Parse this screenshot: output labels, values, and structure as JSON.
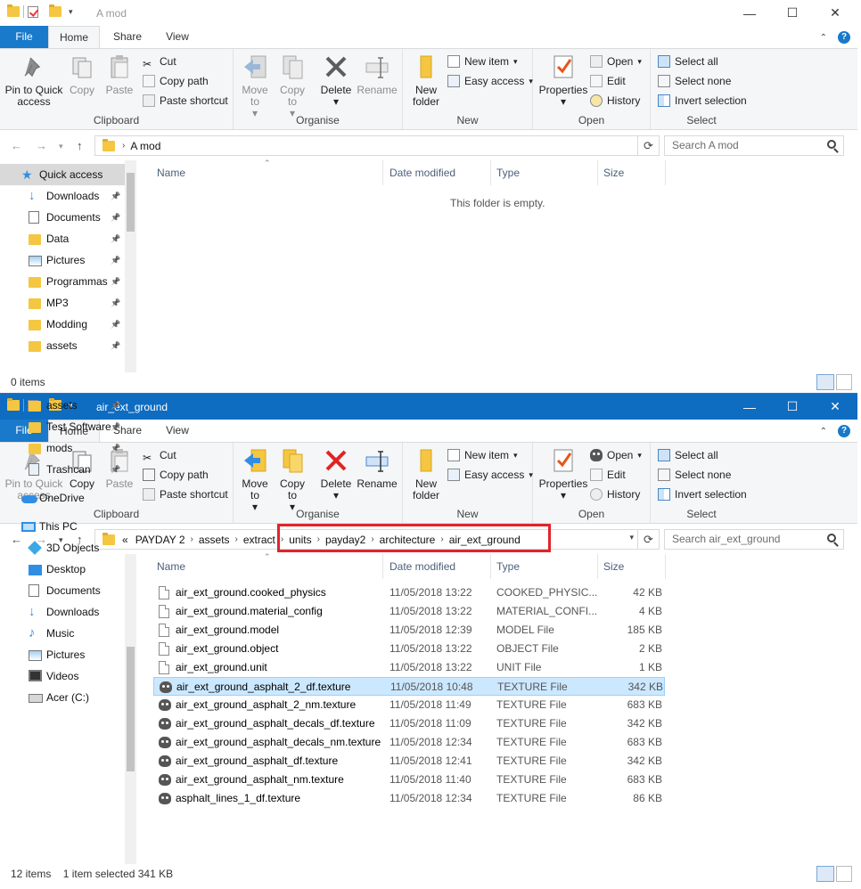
{
  "colors": {
    "accent": "#1979ca",
    "title_active": "#0e6cc1",
    "highlight_box": "#e0242c",
    "selected_row": "#cce8ff"
  },
  "ribbon": {
    "tabs": [
      "File",
      "Home",
      "Share",
      "View"
    ],
    "clipboard": {
      "label": "Clipboard",
      "pin": "Pin to Quick access",
      "copy": "Copy",
      "paste": "Paste",
      "cut": "Cut",
      "copy_path": "Copy path",
      "paste_shortcut": "Paste shortcut"
    },
    "organise": {
      "label": "Organise",
      "move_to": "Move to",
      "copy_to": "Copy to",
      "delete": "Delete",
      "rename": "Rename"
    },
    "new": {
      "label": "New",
      "new_folder": "New folder",
      "new_item": "New item",
      "easy_access": "Easy access"
    },
    "open": {
      "label": "Open",
      "properties": "Properties",
      "open": "Open",
      "edit": "Edit",
      "history": "History"
    },
    "select": {
      "label": "Select",
      "select_all": "Select all",
      "select_none": "Select none",
      "invert": "Invert selection"
    }
  },
  "columns": {
    "name": "Name",
    "date": "Date modified",
    "type": "Type",
    "size": "Size"
  },
  "win1": {
    "title": "A mod",
    "address": [
      "A mod"
    ],
    "search_placeholder": "Search A mod",
    "empty_text": "This folder is empty.",
    "status": "0 items",
    "nav": [
      {
        "label": "Quick access",
        "icon": "star-icon",
        "pin": false
      },
      {
        "label": "Downloads",
        "icon": "download-icon",
        "pin": true
      },
      {
        "label": "Documents",
        "icon": "documents-icon",
        "pin": true
      },
      {
        "label": "Data",
        "icon": "folder-icon",
        "pin": true
      },
      {
        "label": "Pictures",
        "icon": "pictures-icon",
        "pin": true
      },
      {
        "label": "Programmas",
        "icon": "folder-icon",
        "pin": true
      },
      {
        "label": "MP3",
        "icon": "folder-icon",
        "pin": true
      },
      {
        "label": "Modding",
        "icon": "folder-icon",
        "pin": true
      },
      {
        "label": "assets",
        "icon": "folder-icon",
        "pin": true
      }
    ]
  },
  "win2": {
    "title": "air_ext_ground",
    "address_prefix": "«",
    "address": [
      "PAYDAY 2",
      "assets",
      "extract",
      "units",
      "payday2",
      "architecture",
      "air_ext_ground"
    ],
    "search_placeholder": "Search air_ext_ground",
    "status_items": "12 items",
    "status_selected": "1 item selected  341 KB",
    "nav": [
      {
        "label": "assets",
        "icon": "folder-icon",
        "pin": true
      },
      {
        "label": "Test Software",
        "icon": "folder-icon",
        "pin": true
      },
      {
        "label": "mods",
        "icon": "folder-icon",
        "pin": true
      },
      {
        "label": "Trashcan",
        "icon": "recycle-icon",
        "pin": true
      },
      {
        "label": "OneDrive",
        "icon": "onedrive-icon",
        "pin": false
      },
      {
        "label": "This PC",
        "icon": "pc-icon",
        "pin": false
      },
      {
        "label": "3D Objects",
        "icon": "cube-icon",
        "pin": false
      },
      {
        "label": "Desktop",
        "icon": "desktop-icon",
        "pin": false
      },
      {
        "label": "Documents",
        "icon": "documents-icon",
        "pin": false
      },
      {
        "label": "Downloads",
        "icon": "download-icon",
        "pin": false
      },
      {
        "label": "Music",
        "icon": "music-icon",
        "pin": false
      },
      {
        "label": "Pictures",
        "icon": "pictures-icon",
        "pin": false
      },
      {
        "label": "Videos",
        "icon": "videos-icon",
        "pin": false
      },
      {
        "label": "Acer (C:)",
        "icon": "drive-icon",
        "pin": false
      }
    ],
    "files": [
      {
        "name": "air_ext_ground.cooked_physics",
        "date": "11/05/2018 13:22",
        "type": "COOKED_PHYSIC...",
        "size": "42 KB",
        "icon": "doc"
      },
      {
        "name": "air_ext_ground.material_config",
        "date": "11/05/2018 13:22",
        "type": "MATERIAL_CONFI...",
        "size": "4 KB",
        "icon": "doc"
      },
      {
        "name": "air_ext_ground.model",
        "date": "11/05/2018 12:39",
        "type": "MODEL File",
        "size": "185 KB",
        "icon": "doc"
      },
      {
        "name": "air_ext_ground.object",
        "date": "11/05/2018 13:22",
        "type": "OBJECT File",
        "size": "2 KB",
        "icon": "doc"
      },
      {
        "name": "air_ext_ground.unit",
        "date": "11/05/2018 13:22",
        "type": "UNIT File",
        "size": "1 KB",
        "icon": "doc"
      },
      {
        "name": "air_ext_ground_asphalt_2_df.texture",
        "date": "11/05/2018 10:48",
        "type": "TEXTURE File",
        "size": "342 KB",
        "icon": "gimp",
        "selected": true
      },
      {
        "name": "air_ext_ground_asphalt_2_nm.texture",
        "date": "11/05/2018 11:49",
        "type": "TEXTURE File",
        "size": "683 KB",
        "icon": "gimp"
      },
      {
        "name": "air_ext_ground_asphalt_decals_df.texture",
        "date": "11/05/2018 11:09",
        "type": "TEXTURE File",
        "size": "342 KB",
        "icon": "gimp"
      },
      {
        "name": "air_ext_ground_asphalt_decals_nm.texture",
        "date": "11/05/2018 12:34",
        "type": "TEXTURE File",
        "size": "683 KB",
        "icon": "gimp"
      },
      {
        "name": "air_ext_ground_asphalt_df.texture",
        "date": "11/05/2018 12:41",
        "type": "TEXTURE File",
        "size": "342 KB",
        "icon": "gimp"
      },
      {
        "name": "air_ext_ground_asphalt_nm.texture",
        "date": "11/05/2018 11:40",
        "type": "TEXTURE File",
        "size": "683 KB",
        "icon": "gimp"
      },
      {
        "name": "asphalt_lines_1_df.texture",
        "date": "11/05/2018 12:34",
        "type": "TEXTURE File",
        "size": "86 KB",
        "icon": "gimp"
      }
    ]
  }
}
